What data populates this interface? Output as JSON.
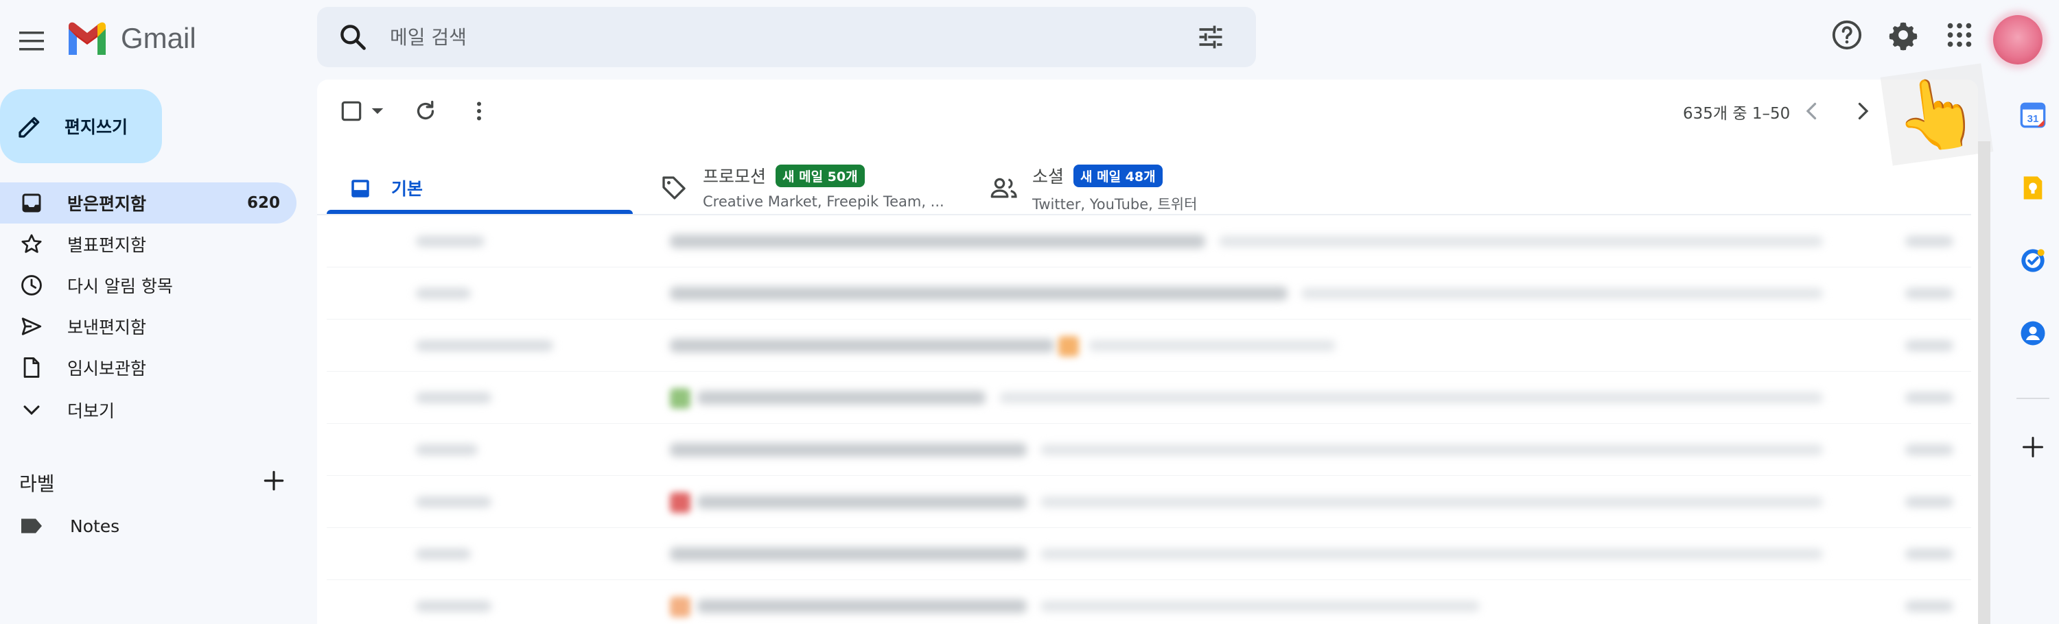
{
  "app": {
    "name": "Gmail"
  },
  "search": {
    "placeholder": "메일 검색"
  },
  "compose": {
    "label": "편지쓰기"
  },
  "sidebar": {
    "items": [
      {
        "label": "받은편지함",
        "count": "620",
        "icon": "inbox-icon",
        "active": true
      },
      {
        "label": "별표편지함",
        "icon": "star-icon"
      },
      {
        "label": "다시 알림 항목",
        "icon": "clock-icon"
      },
      {
        "label": "보낸편지함",
        "icon": "send-icon"
      },
      {
        "label": "임시보관함",
        "icon": "file-icon"
      },
      {
        "label": "더보기",
        "icon": "chevron-down-icon"
      }
    ],
    "labels_heading": "라벨",
    "labels": [
      {
        "label": "Notes",
        "icon": "label-icon"
      }
    ]
  },
  "toolbar": {
    "page_info": "635개 중 1–50"
  },
  "tabs": [
    {
      "label": "기본",
      "icon": "inbox-icon",
      "active": true
    },
    {
      "label": "프로모션",
      "badge": "새 메일 50개",
      "badge_color": "#188038",
      "subtitle": "Creative Market, Freepik Team, ...",
      "icon": "tag-icon"
    },
    {
      "label": "소셜",
      "badge": "새 메일 48개",
      "badge_color": "#0b57d0",
      "subtitle": "Twitter, YouTube, 트위터",
      "icon": "people-icon"
    }
  ],
  "side_panel": {
    "apps": [
      "calendar-icon",
      "keep-icon",
      "tasks-icon",
      "contacts-icon",
      "add-icon"
    ]
  },
  "colors": {
    "accent": "#0b57d0",
    "compose_bg": "#c2e7ff",
    "active_nav_bg": "#d3e3fd",
    "page_bg": "#f6f8fc"
  }
}
